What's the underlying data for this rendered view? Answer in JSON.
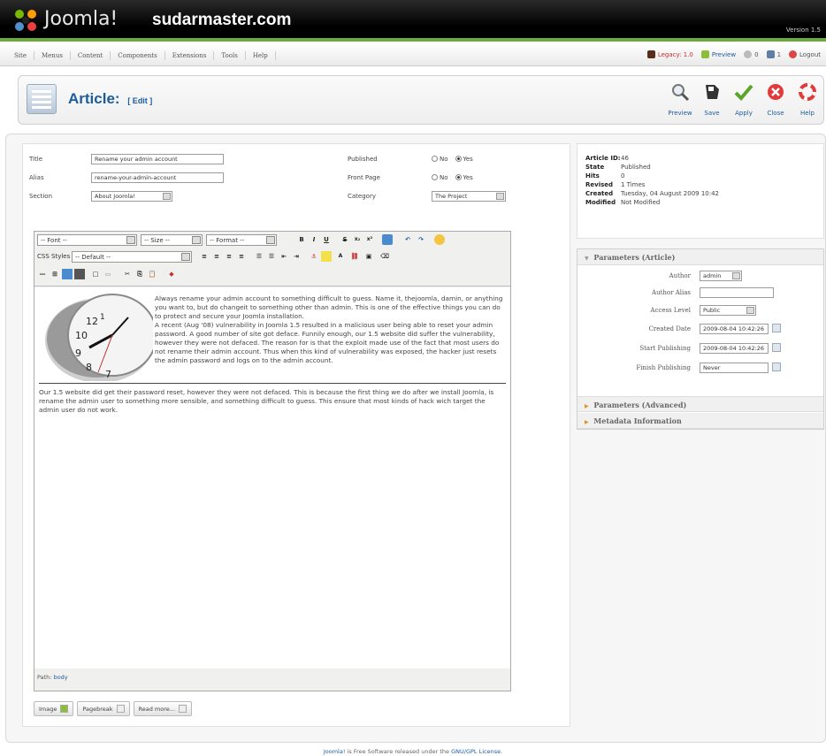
{
  "header": {
    "logo_text": "Joomla!",
    "site_name": "sudarmaster.com",
    "version": "Version 1.5"
  },
  "menu": {
    "items": [
      "Site",
      "Menus",
      "Content",
      "Components",
      "Extensions",
      "Tools",
      "Help"
    ]
  },
  "status": {
    "legacy": "Legacy: 1.0",
    "preview": "Preview",
    "messages_count": "0",
    "users_count": "1",
    "logout": "Logout"
  },
  "toolbar": {
    "title": "Article:",
    "title_mode": "[ Edit ]",
    "buttons": [
      "Preview",
      "Save",
      "Apply",
      "Close",
      "Help"
    ]
  },
  "form": {
    "title_label": "Title",
    "title_value": "Rename your admin account",
    "alias_label": "Alias",
    "alias_value": "rename-your-admin-account",
    "section_label": "Section",
    "section_value": "About Joomla!",
    "published_label": "Published",
    "front_page_label": "Front Page",
    "category_label": "Category",
    "category_value": "The Project",
    "no_label": "No",
    "yes_label": "Yes"
  },
  "editor": {
    "font_select": "-- Font --",
    "size_select": "-- Size --",
    "format_select": "-- Format --",
    "css_label": "CSS Styles",
    "css_select": "-- Default --",
    "paragraph1": "Always rename your admin account to something difficult to guess. Name it, thejoomla, damin, or anything you want to, but do changeit to something other than admin. This is one of the effective things you can do to protect and secure your Joomla installation.",
    "paragraph2": "A recent (Aug '08) vulnerability in Joomla 1.5 resulted in a malicious user being able to reset your admin password. A good number of site got deface. Funnily enough, our 1.5 website did suffer the vulnerability, however they were not defaced. The reason for is that the exploit made use of the fact that most users do not rename their admin account. Thus when this kind of vulnerability was exposed, the hacker just resets the admin password and logs on to the admin account.",
    "paragraph3": "Our 1.5 website did get their password reset, however they were not defaced. This is because the first thing we do after we install Joomla, is rename the admin user to something more sensible, and something difficult to guess. This ensure that most kinds of hack wich target the admin user do not work.",
    "path_label": "Path:",
    "path_value": "body"
  },
  "bottom_buttons": [
    "Image",
    "Pagebreak",
    "Read more..."
  ],
  "info": {
    "article_id_label": "Article ID:",
    "article_id": "46",
    "state_label": "State",
    "state": "Published",
    "hits_label": "Hits",
    "hits": "0",
    "revised_label": "Revised",
    "revised": "1 Times",
    "created_label": "Created",
    "created": "Tuesday, 04 August 2009 10:42",
    "modified_label": "Modified",
    "modified": "Not Modified"
  },
  "params": {
    "header_article": "Parameters (Article)",
    "author_label": "Author",
    "author_value": "admin",
    "author_alias_label": "Author Alias",
    "access_level_label": "Access Level",
    "access_level_value": "Public",
    "created_date_label": "Created Date",
    "created_date_value": "2009-08-04 10:42:26",
    "start_publishing_label": "Start Publishing",
    "start_publishing_value": "2009-08-04 10:42:26",
    "finish_publishing_label": "Finish Publishing",
    "finish_publishing_value": "Never",
    "header_advanced": "Parameters (Advanced)",
    "header_metadata": "Metadata Information"
  },
  "footer": {
    "link1": "Joomla!",
    "text": "is Free Software released under the",
    "link2": "GNU/GPL License."
  },
  "colors": {
    "accent_green": "#6cab3a",
    "link_blue": "#1c5b9c",
    "header_black": "#000000"
  }
}
